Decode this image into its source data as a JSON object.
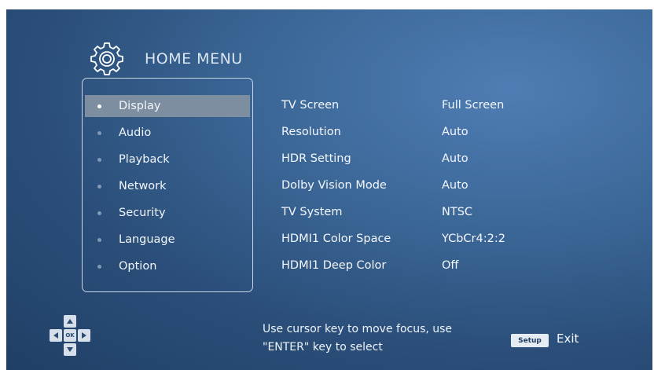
{
  "header": {
    "title": "HOME MENU",
    "icon": "gear-icon"
  },
  "menu": {
    "selected_index": 0,
    "items": [
      {
        "label": "Display"
      },
      {
        "label": "Audio"
      },
      {
        "label": "Playback"
      },
      {
        "label": "Network"
      },
      {
        "label": "Security"
      },
      {
        "label": "Language"
      },
      {
        "label": "Option"
      }
    ]
  },
  "settings": [
    {
      "label": "TV Screen",
      "value": "Full Screen"
    },
    {
      "label": "Resolution",
      "value": "Auto"
    },
    {
      "label": "HDR Setting",
      "value": "Auto"
    },
    {
      "label": "Dolby Vision Mode",
      "value": "Auto"
    },
    {
      "label": "TV System",
      "value": "NTSC"
    },
    {
      "label": "HDMI1 Color Space",
      "value": "YCbCr4:2:2"
    },
    {
      "label": "HDMI1 Deep Color",
      "value": "Off"
    }
  ],
  "footer": {
    "dpad_ok": "OK",
    "hint_line1": "Use cursor key to move focus, use",
    "hint_line2": "\"ENTER\" key to select",
    "setup_badge": "Setup",
    "exit_label": "Exit"
  },
  "colors": {
    "background": "#2e5585",
    "selected_row": "#7e8ea1",
    "border": "#c9d6e6"
  }
}
